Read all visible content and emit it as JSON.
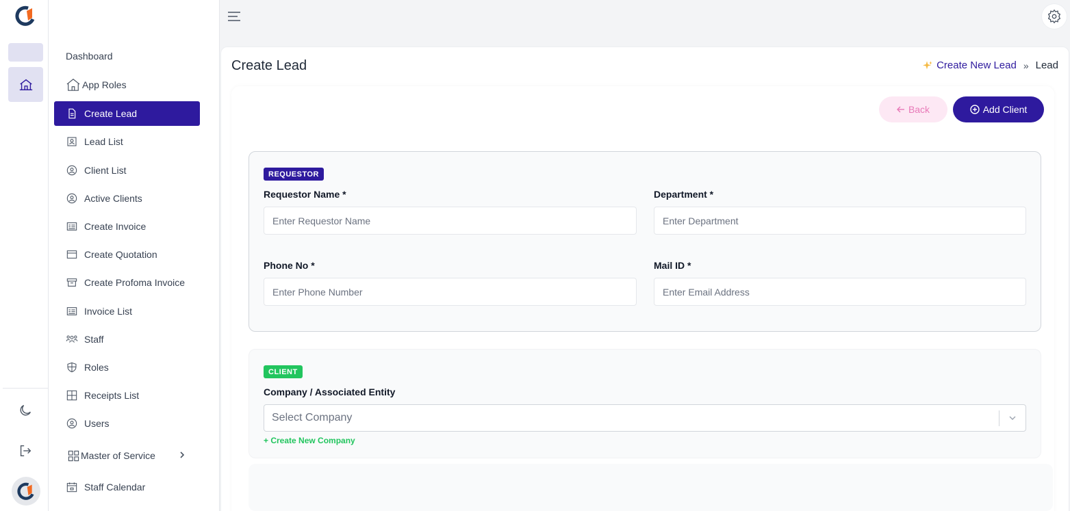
{
  "sidebar": {
    "items": [
      {
        "label": "Dashboard"
      },
      {
        "label": "App Roles"
      },
      {
        "label": "Create Lead"
      },
      {
        "label": "Lead List"
      },
      {
        "label": "Client List"
      },
      {
        "label": "Active Clients"
      },
      {
        "label": "Create Invoice"
      },
      {
        "label": "Create Quotation"
      },
      {
        "label": "Create Profoma Invoice"
      },
      {
        "label": "Invoice List"
      },
      {
        "label": "Staff"
      },
      {
        "label": "Roles"
      },
      {
        "label": "Receipts List"
      },
      {
        "label": "Users"
      },
      {
        "label": "Master of Service"
      },
      {
        "label": "Staff Calendar"
      }
    ],
    "active_item": "Create Lead"
  },
  "page": {
    "title": "Create Lead",
    "breadcrumb": {
      "link": "Create New Lead",
      "separator": "»",
      "current": "Lead"
    }
  },
  "actions": {
    "back_label": "Back",
    "add_client_label": "Add Client"
  },
  "requestor": {
    "badge": "REQUESTOR",
    "name_label": "Requestor Name *",
    "name_placeholder": "Enter Requestor Name",
    "department_label": "Department *",
    "department_placeholder": "Enter Department",
    "phone_label": "Phone No *",
    "phone_placeholder": "Enter Phone Number",
    "mail_label": "Mail ID *",
    "mail_placeholder": "Enter Email Address"
  },
  "client": {
    "badge": "CLIENT",
    "company_label": "Company / Associated Entity",
    "company_placeholder": "Select Company",
    "create_company_link": "+ Create New Company"
  },
  "colors": {
    "primary": "#2e1a9e",
    "success": "#22c55e",
    "back_bg": "#fde8f4",
    "back_text": "#e879b8",
    "logo_orange": "#f26a21",
    "logo_navy": "#1e3a5f"
  },
  "icons": {
    "rail": [
      "logo-icon",
      "home-icon",
      "moon-icon",
      "logout-icon",
      "avatar-logo-icon"
    ],
    "topbar": [
      "hamburger-icon",
      "gear-icon"
    ]
  }
}
